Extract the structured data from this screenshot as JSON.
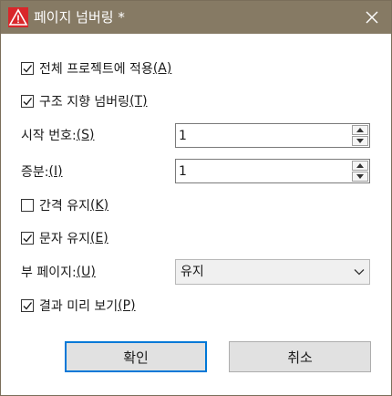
{
  "window": {
    "title": "페이지 넘버링 *",
    "icon": "warning-triangle-icon",
    "accent_color": "#867a64",
    "close_icon": "close-icon"
  },
  "options": {
    "apply_all": {
      "text": "전체 프로젝트에 적용 ",
      "accel": "(A)",
      "checked": true
    },
    "structured": {
      "text": "구조 지향 넘버링 ",
      "accel": "(T)",
      "checked": true
    },
    "keep_spacing": {
      "text": "간격 유지 ",
      "accel": "(K)",
      "checked": false
    },
    "keep_text": {
      "text": "문자 유지 ",
      "accel": "(E)",
      "checked": true
    },
    "preview": {
      "text": "결과 미리 보기 ",
      "accel": "(P)",
      "checked": true
    }
  },
  "fields": {
    "start_number": {
      "label": "시작 번호: ",
      "accel": "(S)",
      "value": "1"
    },
    "increment": {
      "label": "증분: ",
      "accel": "(I)",
      "value": "1"
    },
    "subpage": {
      "label": "부 페이지: ",
      "accel": "(U)",
      "value": "유지"
    }
  },
  "buttons": {
    "ok": "확인",
    "cancel": "취소"
  }
}
